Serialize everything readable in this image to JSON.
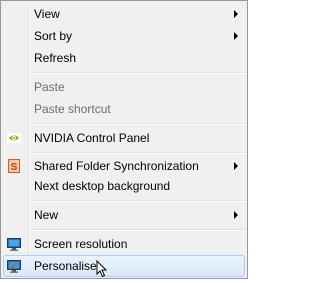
{
  "menu": {
    "items": [
      {
        "label": "View",
        "submenu": true
      },
      {
        "label": "Sort by",
        "submenu": true
      },
      {
        "label": "Refresh"
      },
      {
        "label": "Paste",
        "disabled": true
      },
      {
        "label": "Paste shortcut",
        "disabled": true
      },
      {
        "label": "NVIDIA Control Panel",
        "icon": "nvidia-icon"
      },
      {
        "label": "Shared Folder Synchronization",
        "icon": "shared-folder-sync-icon",
        "submenu": true
      },
      {
        "label": "Next desktop background"
      },
      {
        "label": "New",
        "submenu": true
      },
      {
        "label": "Screen resolution",
        "icon": "monitor-icon"
      },
      {
        "label": "Personalise",
        "icon": "personalise-icon",
        "highlighted": true
      }
    ]
  },
  "colors": {
    "menu_background": "#f0f0f0",
    "disabled_text": "#6d6d6d",
    "highlight_border": "#aecff7",
    "nvidia_green": "#76b900"
  }
}
